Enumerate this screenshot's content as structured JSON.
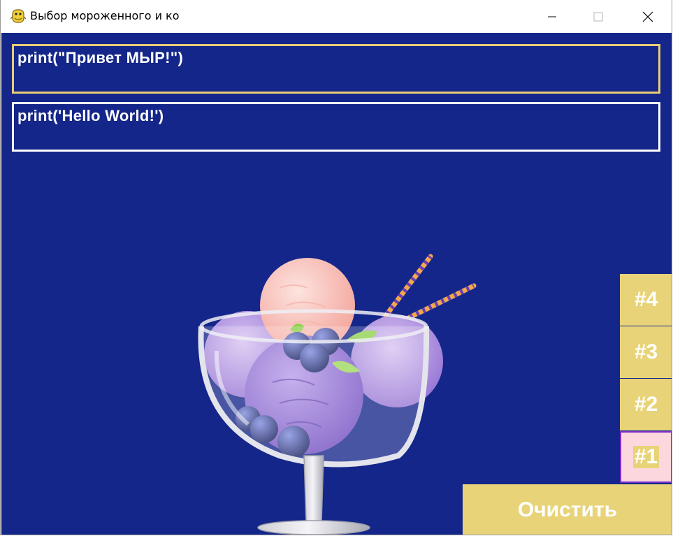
{
  "window": {
    "title": "Выбор мороженного и ко",
    "icon": "python-snake-icon",
    "controls": [
      "minimize-icon",
      "maximize-icon",
      "close-icon"
    ]
  },
  "colors": {
    "background": "#14268a",
    "accent": "#e8d378",
    "active_border": "#e9cd72",
    "selected_tab_bg": "#fcd7dd",
    "selected_tab_border": "#7b2fc9",
    "text": "#ffffff"
  },
  "inputs": [
    {
      "value": "print(\"Привет МЫР!\")",
      "focused": true
    },
    {
      "value": "print('Hello World!')",
      "focused": false
    }
  ],
  "image": {
    "subject": "ice-cream-sundae-icon"
  },
  "tabs": [
    {
      "label": "#4",
      "selected": false
    },
    {
      "label": "#3",
      "selected": false
    },
    {
      "label": "#2",
      "selected": false
    },
    {
      "label": "#1",
      "selected": true
    }
  ],
  "clear_button": {
    "label": "Очистить"
  }
}
